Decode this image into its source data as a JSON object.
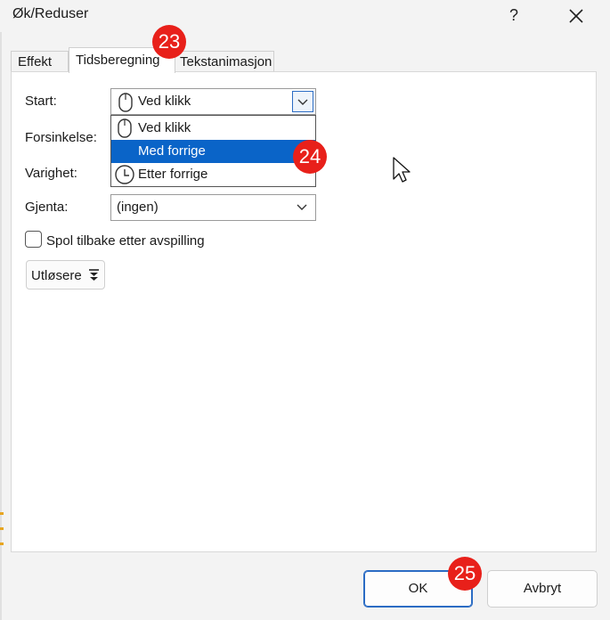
{
  "window": {
    "title": "Øk/Reduser",
    "help_label": "?",
    "close_icon": "close-icon"
  },
  "tabs": [
    {
      "label": "Effekt",
      "active": false
    },
    {
      "label": "Tidsberegning",
      "active": true
    },
    {
      "label": "Tekstanimasjon",
      "active": false
    }
  ],
  "form": {
    "start_label": "Start:",
    "start_value": "Ved klikk",
    "delay_label": "Forsinkelse:",
    "duration_label": "Varighet:",
    "repeat_label": "Gjenta:",
    "repeat_value": "(ingen)",
    "rewind_label": "Spol tilbake etter avspilling",
    "rewind_checked": false,
    "triggers_label": "Utløsere"
  },
  "start_dropdown": {
    "options": [
      {
        "label": "Ved klikk",
        "icon": "mouse-icon"
      },
      {
        "label": "Med forrige",
        "icon": ""
      },
      {
        "label": "Etter forrige",
        "icon": "clock-icon"
      }
    ],
    "selected_index": 1,
    "selected_color": "#0a64c8"
  },
  "buttons": {
    "ok_label": "OK",
    "cancel_label": "Avbryt"
  },
  "annotations": [
    {
      "label": "23"
    },
    {
      "label": "24"
    },
    {
      "label": "25"
    }
  ],
  "colors": {
    "accent": "#2b6cc4",
    "badge": "#e8201a"
  }
}
